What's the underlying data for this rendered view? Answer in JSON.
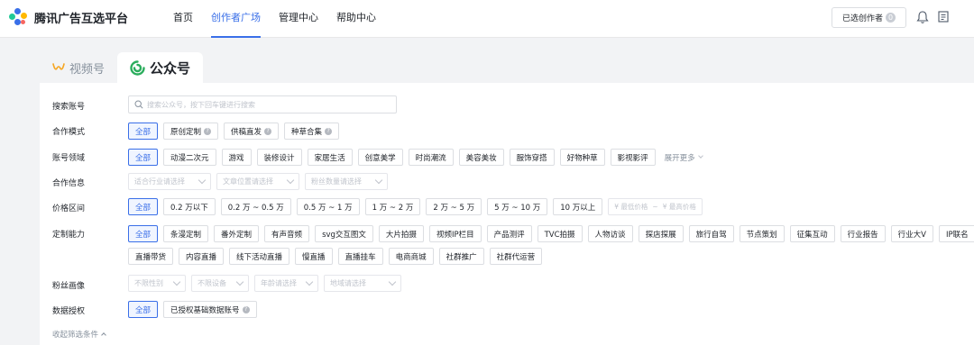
{
  "header": {
    "logo_text": "腾讯广告互选平台",
    "nav": [
      "首页",
      "创作者广场",
      "管理中心",
      "帮助中心"
    ],
    "nav_active": 1,
    "selected_label": "已选创作者",
    "selected_count": "0"
  },
  "tabs": [
    {
      "label": "视频号",
      "active": false
    },
    {
      "label": "公众号",
      "active": true
    }
  ],
  "filters": {
    "search": {
      "label": "搜索账号",
      "placeholder": "搜索公众号，按下回车键进行搜索"
    },
    "mode": {
      "label": "合作模式",
      "options": [
        "全部",
        "原创定制",
        "供稿直发",
        "种草合集"
      ]
    },
    "domain": {
      "label": "账号领域",
      "options": [
        "全部",
        "动漫二次元",
        "游戏",
        "装修设计",
        "家居生活",
        "创意美学",
        "时尚潮流",
        "美容美妆",
        "服饰穿搭",
        "好物种草",
        "影视影评"
      ],
      "expand": "展开更多"
    },
    "coop_info": {
      "label": "合作信息",
      "selects": [
        "适合行业请选择",
        "文章位置请选择",
        "粉丝数量请选择"
      ]
    },
    "price": {
      "label": "价格区间",
      "options": [
        "全部",
        "0.2 万以下",
        "0.2 万 ~ 0.5 万",
        "0.5 万 ~ 1 万",
        "1 万 ~ 2 万",
        "2 万 ~ 5 万",
        "5 万 ~ 10 万",
        "10 万以上"
      ],
      "min_placeholder": "¥ 最低价格",
      "separator": "~",
      "max_placeholder": "¥ 最高价格"
    },
    "custom": {
      "label": "定制能力",
      "row1": [
        "全部",
        "条漫定制",
        "番外定制",
        "有声音频",
        "svg交互图文",
        "大片拍摄",
        "视频IP栏目",
        "产品测评",
        "TVC拍摄",
        "人物访谈",
        "探店探展",
        "旅行自驾",
        "节点策划",
        "征集互动",
        "行业报告",
        "行业大V",
        "IP联名"
      ],
      "row2": [
        "直播带货",
        "内容直播",
        "线下活动直播",
        "慢直播",
        "直播挂车",
        "电商商城",
        "社群推广",
        "社群代运营"
      ]
    },
    "fans": {
      "label": "粉丝画像",
      "selects": [
        "不限性别",
        "不限设备",
        "年龄请选择",
        "地域请选择"
      ]
    },
    "auth": {
      "label": "数据授权",
      "options": [
        "全部",
        "已授权基础数据账号"
      ]
    }
  },
  "collapse_label": "收起筛选条件"
}
